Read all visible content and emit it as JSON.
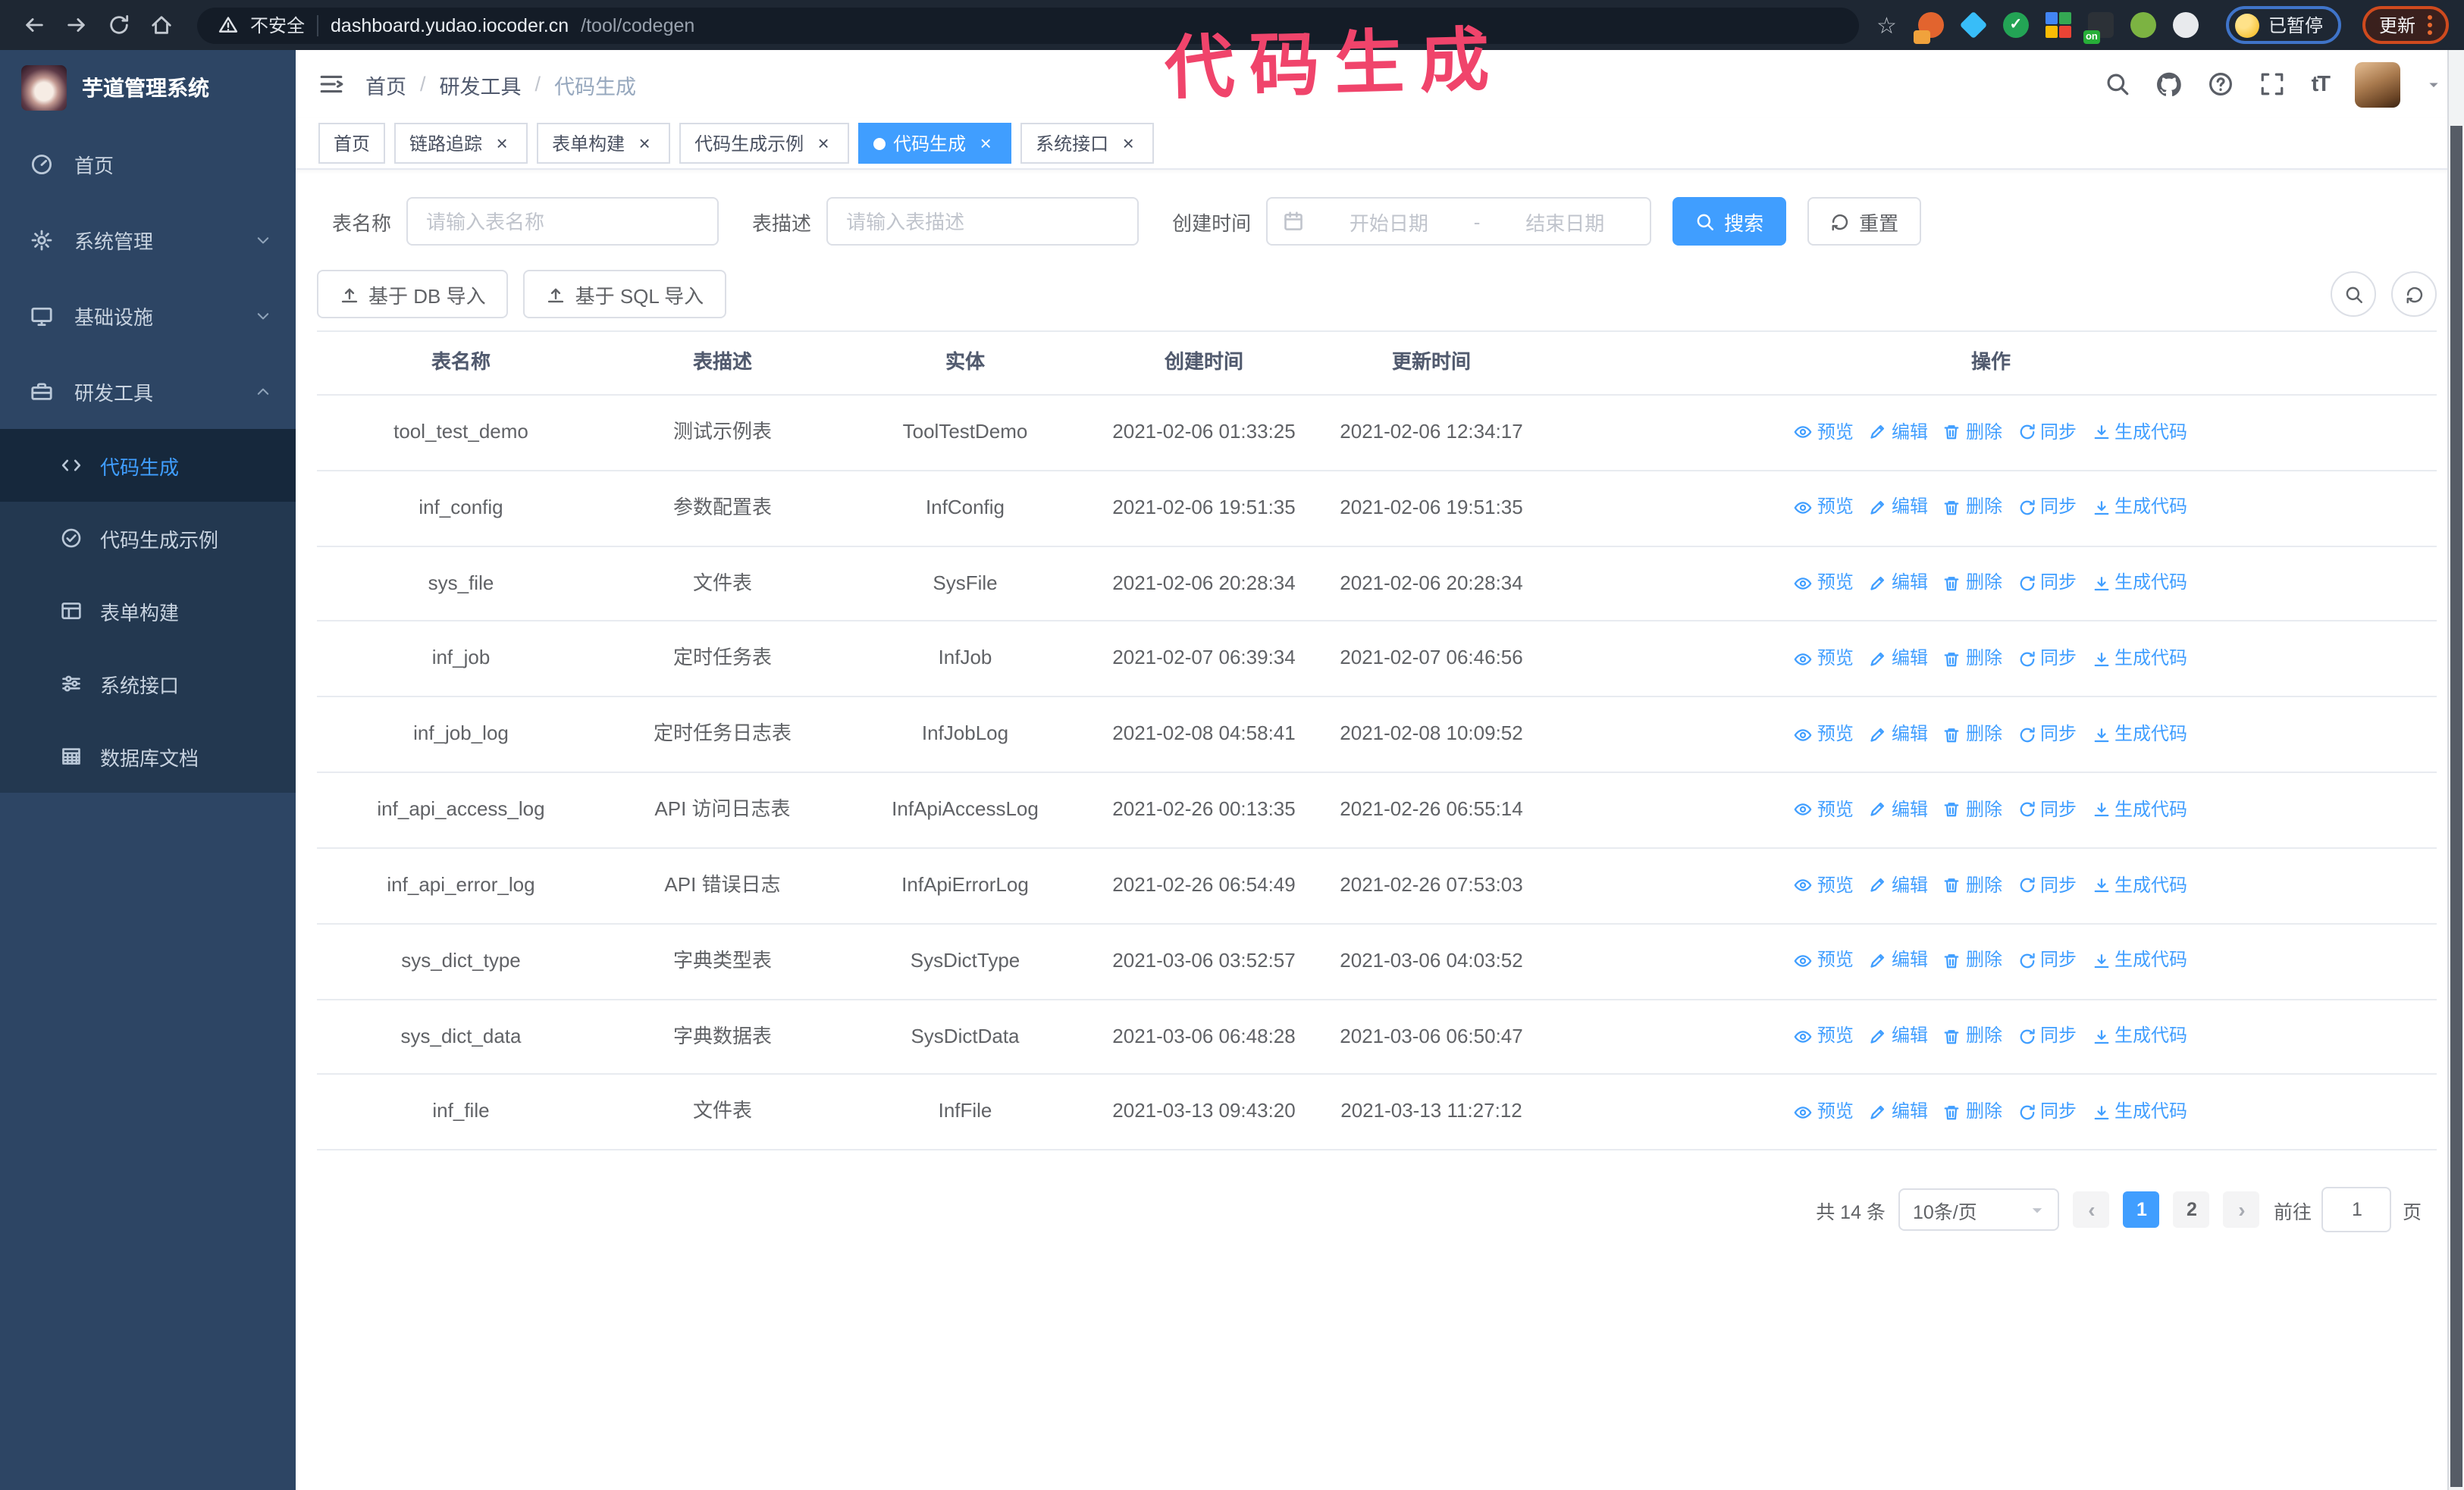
{
  "browser": {
    "security_label": "不安全",
    "url_host": "dashboard.yudao.iocoder.cn",
    "url_path": "/tool/codegen",
    "paused_label": "已暂停",
    "update_label": "更新",
    "extensions": [
      {
        "name": "proxy-extension",
        "shape": "circle",
        "color": "#e2642e",
        "badge": "",
        "badge_color": "#f0a23c"
      },
      {
        "name": "gem-extension",
        "shape": "diamond",
        "color": "#38bdf8"
      },
      {
        "name": "check-extension",
        "shape": "circle",
        "color": "#23a455",
        "glyph": "✓"
      },
      {
        "name": "grid-extension",
        "shape": "grid",
        "color": "#5b8def"
      },
      {
        "name": "onoff-extension",
        "shape": "square",
        "color": "#2c3137",
        "badge": "on",
        "badge_color": "#27ae38"
      },
      {
        "name": "key-extension",
        "shape": "circle",
        "color": "#7cb342"
      },
      {
        "name": "paw-extension",
        "shape": "circle",
        "color": "#e8eaed"
      }
    ]
  },
  "annotation": {
    "text": "代码生成",
    "color": "#f0446b"
  },
  "sidebar": {
    "logo_title": "芋道管理系统",
    "items": [
      {
        "label": "首页",
        "icon": "dashboard"
      },
      {
        "label": "系统管理",
        "icon": "gear",
        "chevron": "down"
      },
      {
        "label": "基础设施",
        "icon": "monitor",
        "chevron": "down"
      },
      {
        "label": "研发工具",
        "icon": "toolbox",
        "chevron": "up"
      }
    ],
    "subitems": [
      {
        "label": "代码生成",
        "icon": "code",
        "active": true
      },
      {
        "label": "代码生成示例",
        "icon": "circlecheck"
      },
      {
        "label": "表单构建",
        "icon": "form"
      },
      {
        "label": "系统接口",
        "icon": "sliders"
      },
      {
        "label": "数据库文档",
        "icon": "dbdoc"
      }
    ]
  },
  "header": {
    "breadcrumb": [
      "首页",
      "研发工具",
      "代码生成"
    ]
  },
  "tabs": [
    {
      "label": "首页",
      "closable": false,
      "active": false
    },
    {
      "label": "链路追踪",
      "closable": true,
      "active": false
    },
    {
      "label": "表单构建",
      "closable": true,
      "active": false
    },
    {
      "label": "代码生成示例",
      "closable": true,
      "active": false
    },
    {
      "label": "代码生成",
      "closable": true,
      "active": true
    },
    {
      "label": "系统接口",
      "closable": true,
      "active": false
    }
  ],
  "filters": {
    "table_name_label": "表名称",
    "table_name_placeholder": "请输入表名称",
    "table_desc_label": "表描述",
    "table_desc_placeholder": "请输入表描述",
    "create_time_label": "创建时间",
    "date_start_placeholder": "开始日期",
    "date_separator": "-",
    "date_end_placeholder": "结束日期",
    "search_label": "搜索",
    "reset_label": "重置"
  },
  "toolbar": {
    "import_db_label": "基于 DB 导入",
    "import_sql_label": "基于 SQL 导入"
  },
  "table": {
    "columns": [
      "表名称",
      "表描述",
      "实体",
      "创建时间",
      "更新时间",
      "操作"
    ],
    "actions": [
      {
        "label": "预览",
        "icon": "eye"
      },
      {
        "label": "编辑",
        "icon": "edit"
      },
      {
        "label": "删除",
        "icon": "trash"
      },
      {
        "label": "同步",
        "icon": "sync"
      },
      {
        "label": "生成代码",
        "icon": "download"
      }
    ],
    "rows": [
      {
        "name": "tool_test_demo",
        "desc": "测试示例表",
        "entity": "ToolTestDemo",
        "created": "2021-02-06 01:33:25",
        "updated": "2021-02-06 12:34:17"
      },
      {
        "name": "inf_config",
        "desc": "参数配置表",
        "entity": "InfConfig",
        "created": "2021-02-06 19:51:35",
        "updated": "2021-02-06 19:51:35"
      },
      {
        "name": "sys_file",
        "desc": "文件表",
        "entity": "SysFile",
        "created": "2021-02-06 20:28:34",
        "updated": "2021-02-06 20:28:34"
      },
      {
        "name": "inf_job",
        "desc": "定时任务表",
        "entity": "InfJob",
        "created": "2021-02-07 06:39:34",
        "updated": "2021-02-07 06:46:56"
      },
      {
        "name": "inf_job_log",
        "desc": "定时任务日志表",
        "entity": "InfJobLog",
        "created": "2021-02-08 04:58:41",
        "updated": "2021-02-08 10:09:52"
      },
      {
        "name": "inf_api_access_log",
        "desc": "API 访问日志表",
        "entity": "InfApiAccessLog",
        "created": "2021-02-26 00:13:35",
        "updated": "2021-02-26 06:55:14"
      },
      {
        "name": "inf_api_error_log",
        "desc": "API 错误日志",
        "entity": "InfApiErrorLog",
        "created": "2021-02-26 06:54:49",
        "updated": "2021-02-26 07:53:03"
      },
      {
        "name": "sys_dict_type",
        "desc": "字典类型表",
        "entity": "SysDictType",
        "created": "2021-03-06 03:52:57",
        "updated": "2021-03-06 04:03:52"
      },
      {
        "name": "sys_dict_data",
        "desc": "字典数据表",
        "entity": "SysDictData",
        "created": "2021-03-06 06:48:28",
        "updated": "2021-03-06 06:50:47"
      },
      {
        "name": "inf_file",
        "desc": "文件表",
        "entity": "InfFile",
        "created": "2021-03-13 09:43:20",
        "updated": "2021-03-13 11:27:12"
      }
    ]
  },
  "pagination": {
    "total": "共 14 条",
    "page_size": "10条/页",
    "pages": [
      "1",
      "2"
    ],
    "active_page": "1",
    "goto_label": "前往",
    "goto_value": "1",
    "page_suffix": "页"
  },
  "colors": {
    "accent": "#409eff",
    "sidebar_bg": "#2d4564",
    "annotation": "#f0446b"
  }
}
